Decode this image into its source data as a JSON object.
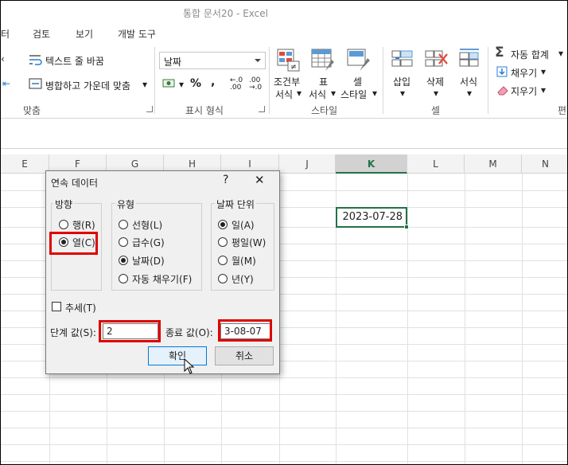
{
  "window": {
    "title": "통합 문서20 - Excel"
  },
  "tabs": [
    "터",
    "검토",
    "보기",
    "개발 도구"
  ],
  "ribbon": {
    "align": {
      "wrap_text": "텍스트 줄 바꿈",
      "merge_center": "병합하고 가운데 맞춤",
      "label": "맞춤"
    },
    "number": {
      "format": "날짜",
      "label": "표시 형식"
    },
    "styles": {
      "conditional": "조건부",
      "conditional2": "서식",
      "table": "표",
      "table2": "서식",
      "cell": "셀",
      "cell2": "스타일",
      "label": "스타일"
    },
    "cells": {
      "insert": "삽입",
      "delete": "삭제",
      "format": "서식",
      "label": "셀"
    },
    "editing": {
      "autosum": "자동 합계",
      "fill": "채우기",
      "clear": "지우기",
      "label": "편"
    }
  },
  "columns": [
    "E",
    "F",
    "G",
    "H",
    "I",
    "J",
    "K",
    "L",
    "M",
    "N"
  ],
  "selected_column": "K",
  "cell_k": {
    "value": "2023-07-28"
  },
  "dialog": {
    "title": "연속 데이터",
    "help": "?",
    "close": "✕",
    "direction": {
      "label": "방향",
      "row": "행(R)",
      "col": "열(C)",
      "selected": "col"
    },
    "type": {
      "label": "유형",
      "linear": "선형(L)",
      "growth": "급수(G)",
      "date": "날짜(D)",
      "autofill": "자동 채우기(F)",
      "selected": "date"
    },
    "date_unit": {
      "label": "날짜 단위",
      "day": "일(A)",
      "weekday": "평일(W)",
      "month": "월(M)",
      "year": "년(Y)",
      "selected": "day"
    },
    "trend": "추세(T)",
    "step_label": "단계 값(S):",
    "step_value": "2",
    "stop_label": "종료 값(O):",
    "stop_value": "3-08-07",
    "ok": "확인",
    "cancel": "취소"
  }
}
